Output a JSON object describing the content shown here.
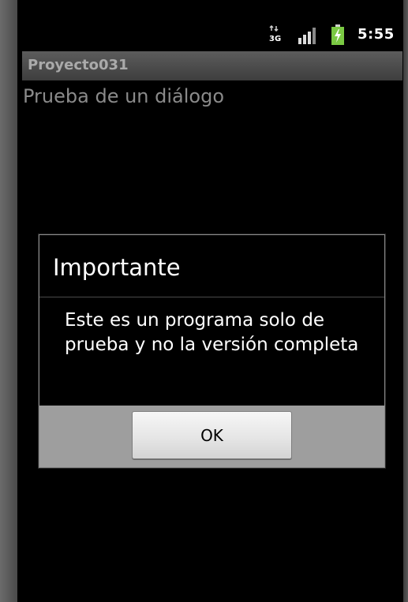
{
  "status_bar": {
    "network_icon": "3g-network-icon",
    "network_label": "3G",
    "signal_icon": "signal-strength-icon",
    "battery_icon": "battery-charging-icon",
    "time": "5:55"
  },
  "app": {
    "title": "Proyecto031",
    "content_text": "Prueba de un diálogo"
  },
  "dialog": {
    "title": "Importante",
    "message": "Este es un programa solo de prueba y no la versión completa",
    "ok_label": "OK"
  },
  "colors": {
    "battery_green": "#7ac943",
    "dialog_button_bar": "#9e9e9e",
    "content_text": "#8a8a8a"
  }
}
